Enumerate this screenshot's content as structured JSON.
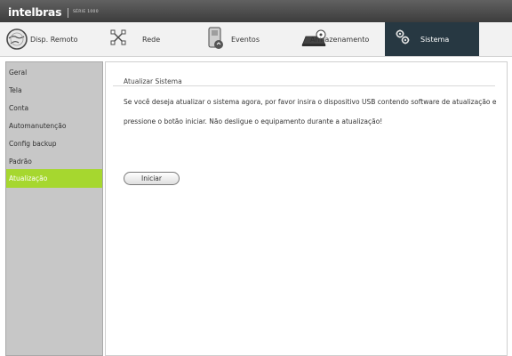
{
  "header": {
    "brand": "intelbras",
    "series": "SÉRIE 1000"
  },
  "tabs": [
    {
      "label": "Disp. Remoto",
      "icon": "globe-icon"
    },
    {
      "label": "Rede",
      "icon": "network-icon"
    },
    {
      "label": "Eventos",
      "icon": "events-icon"
    },
    {
      "label": "Armazenamento",
      "icon": "storage-icon"
    },
    {
      "label": "Sistema",
      "icon": "gears-icon",
      "active": true
    }
  ],
  "sidebar": {
    "items": [
      {
        "label": "Geral"
      },
      {
        "label": "Tela"
      },
      {
        "label": "Conta"
      },
      {
        "label": "Automanutenção"
      },
      {
        "label": "Config backup"
      },
      {
        "label": "Padrão"
      },
      {
        "label": "Atualização",
        "active": true
      }
    ]
  },
  "main": {
    "section_title": "Atualizar Sistema",
    "description": "Se você deseja atualizar o sistema agora, por favor insira o dispositivo USB contendo software de atualização e pressione o botão iniciar. Não desligue o equipamento durante a atualização!",
    "start_button": "Iniciar"
  },
  "colors": {
    "active_tab": "#273842",
    "active_sidebar": "#a6d72f",
    "sidebar_bg": "#c7c7c7",
    "titlebar": "#4a4a4a"
  }
}
